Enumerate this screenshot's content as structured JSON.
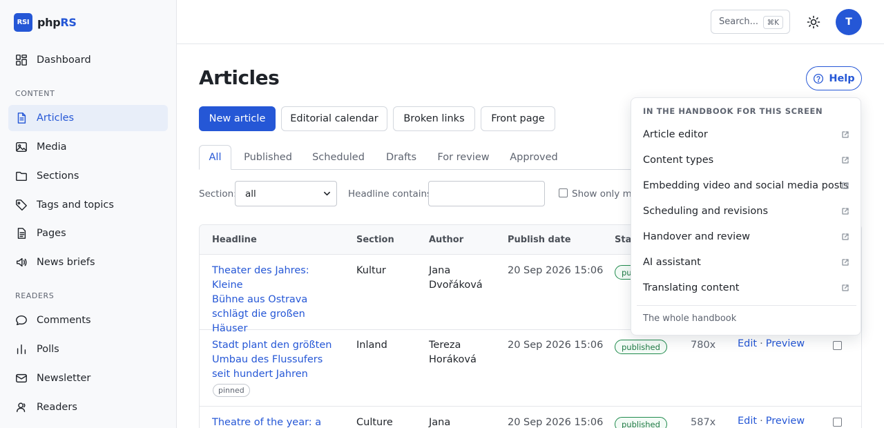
{
  "brand": {
    "logo": "RSI",
    "name_prefix": "php",
    "name_suffix": "RS"
  },
  "sidebar": {
    "dashboard": "Dashboard",
    "content_heading": "CONTENT",
    "content_items": [
      {
        "label": "Articles",
        "icon": "document-icon",
        "active": true
      },
      {
        "label": "Media",
        "icon": "image-icon"
      },
      {
        "label": "Sections",
        "icon": "folder-icon"
      },
      {
        "label": "Tags and topics",
        "icon": "tag-icon"
      },
      {
        "label": "Pages",
        "icon": "page-icon"
      },
      {
        "label": "News briefs",
        "icon": "megaphone-icon"
      }
    ],
    "readers_heading": "READERS",
    "readers_items": [
      {
        "label": "Comments",
        "icon": "comment-icon"
      },
      {
        "label": "Polls",
        "icon": "bar-chart-icon"
      },
      {
        "label": "Newsletter",
        "icon": "mail-icon"
      },
      {
        "label": "Readers",
        "icon": "user-icon"
      }
    ]
  },
  "topbar": {
    "search_placeholder": "Search...",
    "search_shortcut": "⌘K",
    "avatar_initial": "T"
  },
  "page": {
    "title": "Articles",
    "help_label": "Help",
    "actions": [
      "New article",
      "Editorial calendar",
      "Broken links",
      "Front page"
    ],
    "tabs": [
      "All",
      "Published",
      "Scheduled",
      "Drafts",
      "For review",
      "Approved"
    ],
    "active_tab": "All"
  },
  "filters": {
    "section_label": "Section:",
    "section_value": "all",
    "headline_label": "Headline contains:",
    "headline_value": "",
    "show_only_label": "Show only my"
  },
  "table": {
    "headers": [
      "Headline",
      "Section",
      "Author",
      "Publish date",
      "Stat"
    ],
    "rows": [
      {
        "headline": [
          "Theater des Jahres: Kleine",
          "Bühne aus Ostrava",
          "schlägt die großen",
          "Häuser"
        ],
        "section": "Kultur",
        "author": [
          "Jana",
          "Dvořáková"
        ],
        "date": "20 Sep 2026 15:06",
        "status": "pu",
        "views": "",
        "edit": "",
        "preview": ""
      },
      {
        "headline": [
          "Stadt plant den größten",
          "Umbau des Flussufers",
          "seit hundert Jahren"
        ],
        "pinned": "pinned",
        "section": "Inland",
        "author": [
          "Tereza",
          "Horáková"
        ],
        "date": "20 Sep 2026 15:06",
        "status": "published",
        "views": "780x",
        "edit": "Edit",
        "preview": "Preview"
      },
      {
        "headline": [
          "Theatre of the year: a"
        ],
        "section": "Culture",
        "author": [
          "Jana"
        ],
        "date": "20 Sep 2026 15:06",
        "status": "published",
        "views": "587x",
        "edit": "Edit",
        "preview": "Preview"
      }
    ]
  },
  "help_popover": {
    "heading": "IN THE HANDBOOK FOR THIS SCREEN",
    "items": [
      "Article editor",
      "Content types",
      "Embedding video and social media posts",
      "Scheduling and revisions",
      "Handover and review",
      "AI assistant",
      "Translating content"
    ],
    "footer": "The whole handbook"
  },
  "colors": {
    "accent": "#2557d6",
    "status_green": "#1f8a4c",
    "sidebar_bg": "#f8f9fb",
    "active_bg": "#e8eef9"
  }
}
